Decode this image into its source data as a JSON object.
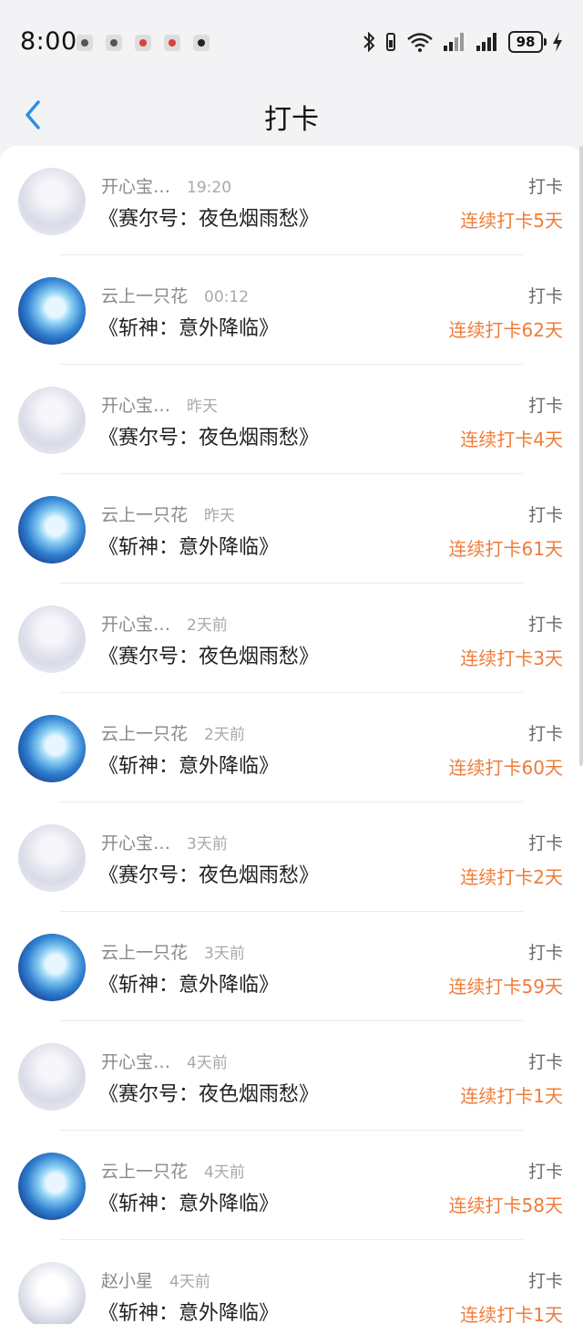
{
  "status_bar": {
    "time": "8:00",
    "battery": "98"
  },
  "header": {
    "title": "打卡"
  },
  "items": [
    {
      "user": "开心宝…",
      "time": "19:20",
      "title": "《赛尔号：夜色烟雨愁》",
      "action": "打卡",
      "streak": "连续打卡5天",
      "avatar": "white"
    },
    {
      "user": "云上一只花",
      "time": "00:12",
      "title": "《斩神：意外降临》",
      "action": "打卡",
      "streak": "连续打卡62天",
      "avatar": "blue"
    },
    {
      "user": "开心宝…",
      "time": "昨天",
      "title": "《赛尔号：夜色烟雨愁》",
      "action": "打卡",
      "streak": "连续打卡4天",
      "avatar": "white"
    },
    {
      "user": "云上一只花",
      "time": "昨天",
      "title": "《斩神：意外降临》",
      "action": "打卡",
      "streak": "连续打卡61天",
      "avatar": "blue"
    },
    {
      "user": "开心宝…",
      "time": "2天前",
      "title": "《赛尔号：夜色烟雨愁》",
      "action": "打卡",
      "streak": "连续打卡3天",
      "avatar": "white"
    },
    {
      "user": "云上一只花",
      "time": "2天前",
      "title": "《斩神：意外降临》",
      "action": "打卡",
      "streak": "连续打卡60天",
      "avatar": "blue"
    },
    {
      "user": "开心宝…",
      "time": "3天前",
      "title": "《赛尔号：夜色烟雨愁》",
      "action": "打卡",
      "streak": "连续打卡2天",
      "avatar": "white"
    },
    {
      "user": "云上一只花",
      "time": "3天前",
      "title": "《斩神：意外降临》",
      "action": "打卡",
      "streak": "连续打卡59天",
      "avatar": "blue"
    },
    {
      "user": "开心宝…",
      "time": "4天前",
      "title": "《赛尔号：夜色烟雨愁》",
      "action": "打卡",
      "streak": "连续打卡1天",
      "avatar": "white"
    },
    {
      "user": "云上一只花",
      "time": "4天前",
      "title": "《斩神：意外降临》",
      "action": "打卡",
      "streak": "连续打卡58天",
      "avatar": "blue"
    },
    {
      "user": "赵小星",
      "time": "4天前",
      "title": "《斩神：意外降临》",
      "action": "打卡",
      "streak": "连续打卡1天",
      "avatar": "white2"
    }
  ],
  "colors": {
    "accent": "#2f8fe6",
    "streak": "#ee7c3a",
    "muted": "#8a8a8a"
  }
}
